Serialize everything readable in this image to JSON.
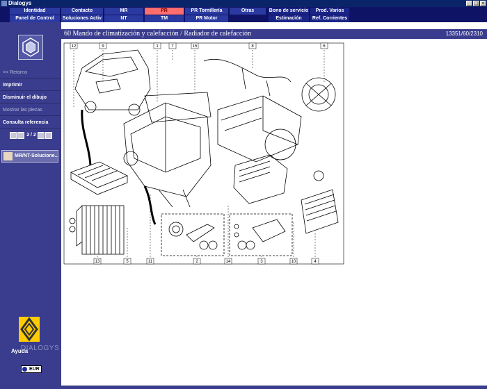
{
  "window": {
    "title": "Dialogys"
  },
  "nav": {
    "row1": [
      {
        "label": "Identidad",
        "active": false
      },
      {
        "label": "Contacto",
        "active": false
      },
      {
        "label": "MR",
        "active": false
      },
      {
        "label": "PR",
        "active": true
      },
      {
        "label": "PR Tornillería",
        "active": false
      },
      {
        "label": "Otras",
        "active": false
      },
      {
        "label": "Bono de servicio",
        "active": false
      },
      {
        "label": "Prod. Varios",
        "active": false
      }
    ],
    "row2": [
      {
        "label": "Panel de Control"
      },
      {
        "label": "Soluciones Activ"
      },
      {
        "label": "NT"
      },
      {
        "label": "TM"
      },
      {
        "label": "PR Motor"
      },
      {
        "label": "Estimación"
      },
      {
        "label": "Ref. Corrientes"
      }
    ]
  },
  "sidebar": {
    "back": "<< Retorno",
    "print": "Imprimir",
    "shrink": "Disminuir el dibujo",
    "show_parts": "Mostrar las piezas",
    "lookup": "Consulta referencia",
    "page": "2 / 2",
    "mr_button": "MR/NT-Solucione...",
    "help": "Ayuda",
    "watermark": "DIALOGYS",
    "currency": "EUR"
  },
  "content": {
    "title": "60 Mando de climatización y calefacción / Radiador de calefacción",
    "ref": "13351/60/2310"
  },
  "diagram": {
    "callouts_top": [
      "12",
      "9",
      "1",
      "7",
      "15",
      "8",
      "6"
    ],
    "callouts_bottom": [
      "13",
      "5",
      "11",
      "2",
      "14",
      "3",
      "10",
      "4"
    ]
  }
}
